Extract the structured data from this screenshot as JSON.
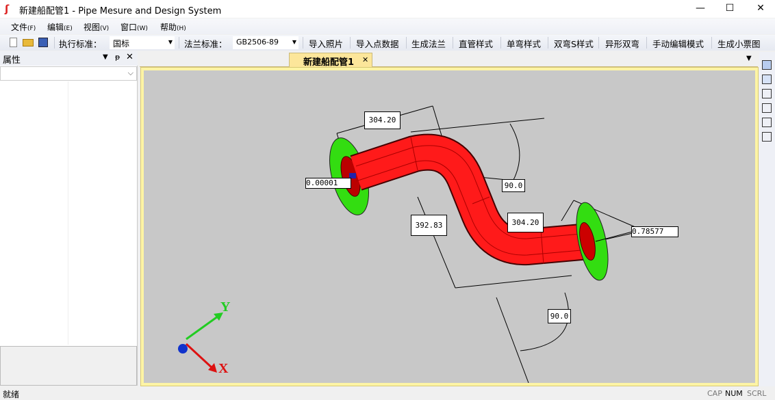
{
  "window": {
    "title": "新建船配管1 - Pipe Mesure and Design System",
    "minimize": "—",
    "maximize": "☐",
    "close": "✕"
  },
  "menu": [
    {
      "label": "文件",
      "key": "(F)"
    },
    {
      "label": "编辑",
      "key": "(E)"
    },
    {
      "label": "视图",
      "key": "(V)"
    },
    {
      "label": "窗口",
      "key": "(W)"
    },
    {
      "label": "帮助",
      "key": "(H)"
    }
  ],
  "toolbar": {
    "standard_label": "执行标准：",
    "standard_value": "国标",
    "flange_label": "法兰标准：",
    "flange_value": "GB2506-89",
    "buttons": [
      "导入照片",
      "导入点数据",
      "生成法兰",
      "直管样式",
      "单弯样式",
      "双弯S样式",
      "异形双弯",
      "手动编辑模式",
      "生成小票图"
    ]
  },
  "left_panel": {
    "title": "属性"
  },
  "tab": {
    "label": "新建船配管1"
  },
  "viewport": {
    "dimensions": [
      "304.20",
      "0.00001",
      "90.0",
      "392.83",
      "304.20",
      "0.78577",
      "90.0"
    ],
    "axis_x": "X",
    "axis_y": "Y",
    "pipe_color": "#ff1a1a",
    "flange_color": "#33dd11"
  },
  "status": {
    "text": "就绪",
    "cap": "CAP",
    "num": "NUM",
    "scrl": "SCRL"
  }
}
